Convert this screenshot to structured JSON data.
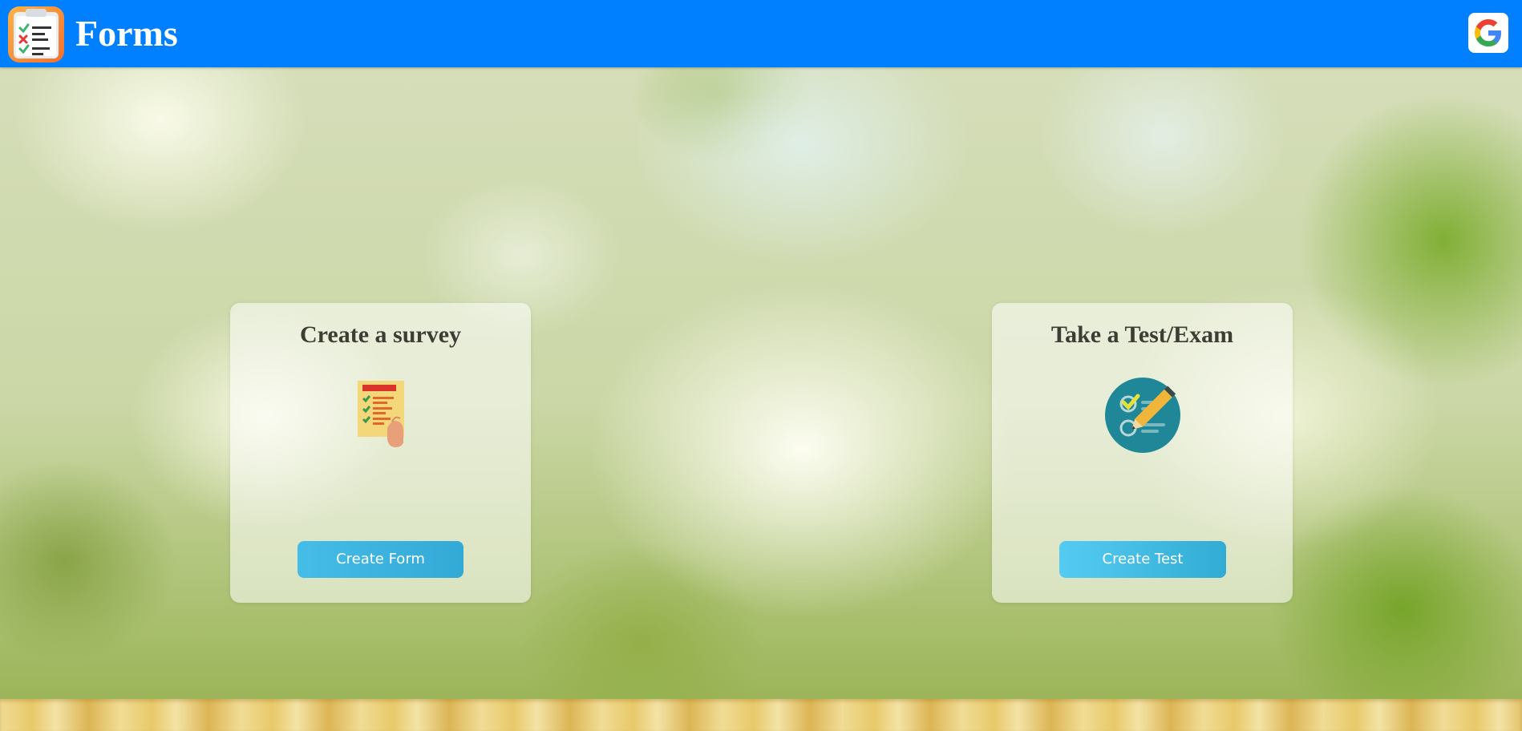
{
  "header": {
    "title": "Forms",
    "logo_icon": "clipboard-checklist-icon",
    "signin_icon": "google-icon",
    "background_color": "#0080ff"
  },
  "cards": [
    {
      "title": "Create a survey",
      "icon": "survey-checklist-icon",
      "button_label": "Create Form"
    },
    {
      "title": "Take a Test/Exam",
      "icon": "test-checklist-pencil-icon",
      "button_label": "Create Test"
    }
  ],
  "colors": {
    "button": "#3bb3e0",
    "title_text": "#3d3d33"
  }
}
